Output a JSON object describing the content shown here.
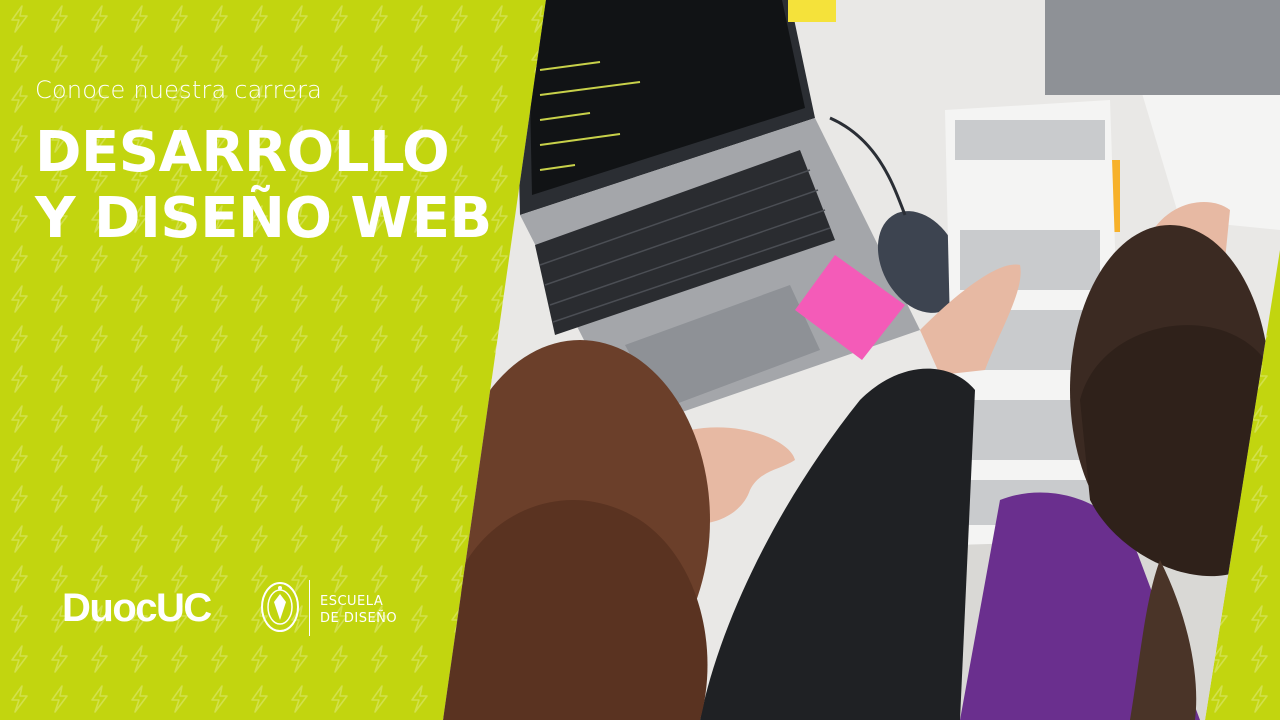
{
  "hero": {
    "subtitle": "Conoce nuestra carrera",
    "title_line1": "DESARROLLO",
    "title_line2": "Y DISEÑO WEB"
  },
  "brand": {
    "name": "DuocUC",
    "school_line1": "ESCUELA",
    "school_line2": "DE DISEÑO"
  },
  "colors": {
    "accent": "#c2d50f",
    "text": "#ffffff"
  }
}
